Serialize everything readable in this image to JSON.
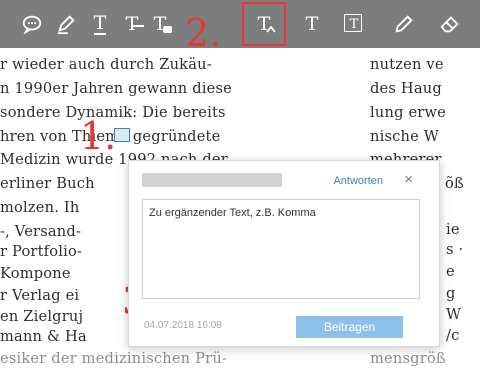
{
  "toolbar": {
    "tools": [
      {
        "icon": "speech-bubble-icon"
      },
      {
        "icon": "pen-icon"
      },
      {
        "icon": "underline-text-icon",
        "glyph": "T"
      },
      {
        "icon": "strikethrough-text-icon",
        "glyph": "T"
      },
      {
        "icon": "text-highlight-icon",
        "glyph": "T"
      },
      {
        "icon": "replace-text-icon",
        "glyph": "T"
      },
      {
        "icon": "text-icon",
        "glyph": "T"
      },
      {
        "icon": "text-box-icon",
        "glyph": "T"
      },
      {
        "icon": "pencil-icon"
      },
      {
        "icon": "eraser-icon"
      }
    ],
    "selected_tool": "replace-text-icon",
    "highlight_color": "#e53935"
  },
  "steps": {
    "one": "1.",
    "two": "2.",
    "three": "3."
  },
  "document": {
    "left_lines": [
      "r wieder auch durch Zukäu-",
      "n 1990er Jahren gewann diese",
      "sondere Dynamik: Die bereits",
      "hren von Thieme gegründete",
      "Medizin wurde 1992 nach der",
      "erliner Buch",
      "molzen. Ih",
      "-, Versand-",
      "r Portfolio-",
      " Kompone",
      "r Verlag ei",
      "en Zielgruj",
      "mann & Ha",
      "esiker der medizinischen Prü-"
    ],
    "right_lines": [
      "nutzen ve",
      "des Haug",
      "lung erwe",
      "nische W",
      "mehrerer",
      "õß",
      "",
      "ie",
      "s ·",
      "e",
      "g",
      "W",
      "/c",
      "mensgröß"
    ]
  },
  "comment": {
    "reply_label": "Antworten",
    "close_label": "×",
    "text": "Zu ergänzender Text, z.B. Komma",
    "date": "04.07.2018 16:08",
    "submit_label": "Beitragen"
  }
}
